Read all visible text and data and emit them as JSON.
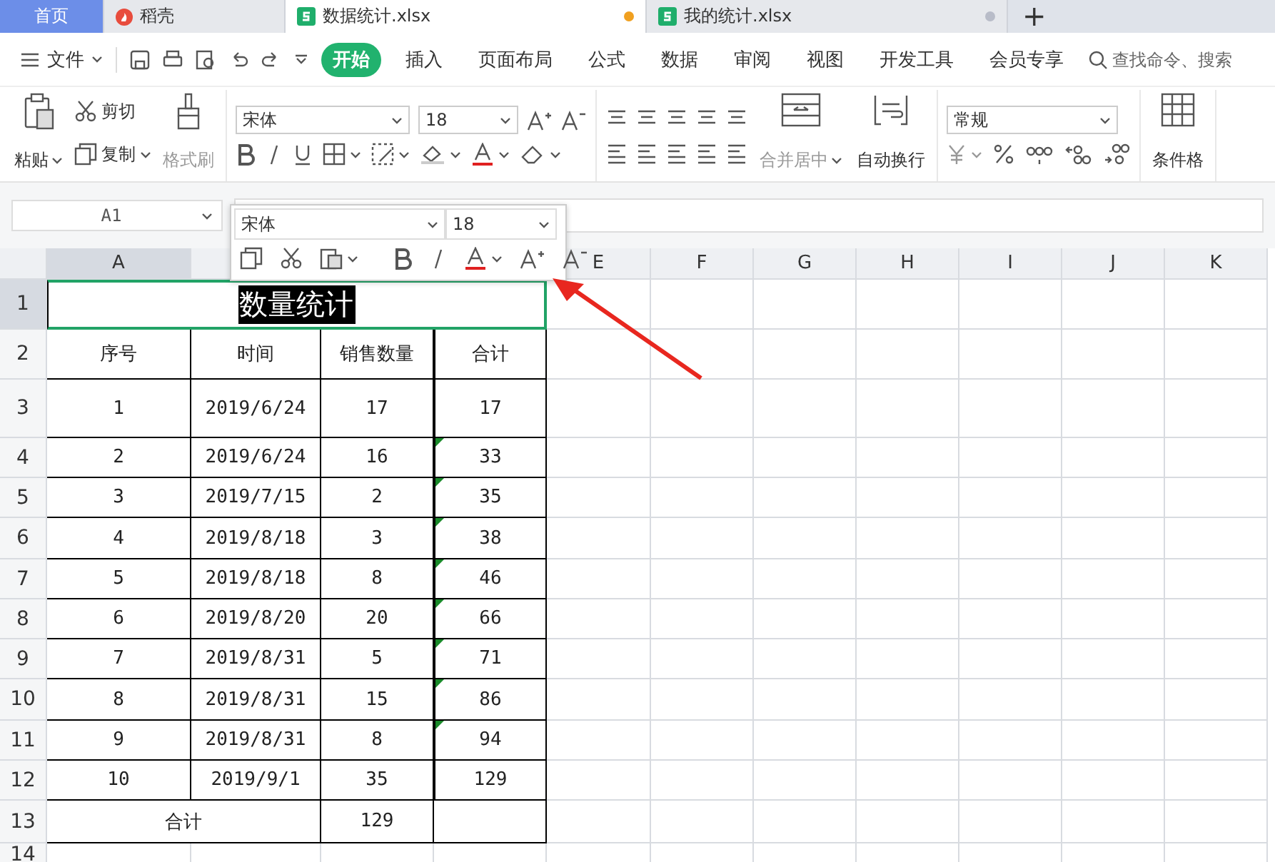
{
  "tabs": [
    {
      "label": "首页",
      "kind": "home",
      "selected": false
    },
    {
      "label": "稻壳",
      "kind": "docer",
      "selected": false
    },
    {
      "label": "数据统计.xlsx",
      "kind": "sheet",
      "selected": true,
      "unsaved": true
    },
    {
      "label": "我的统计.xlsx",
      "kind": "sheet",
      "selected": false,
      "unsaved": false
    }
  ],
  "new_tab": "+",
  "menu": {
    "file": "文件",
    "items": [
      {
        "label": "开始",
        "selected": true
      },
      {
        "label": "插入",
        "selected": false
      },
      {
        "label": "页面布局",
        "selected": false
      },
      {
        "label": "公式",
        "selected": false
      },
      {
        "label": "数据",
        "selected": false
      },
      {
        "label": "审阅",
        "selected": false
      },
      {
        "label": "视图",
        "selected": false
      },
      {
        "label": "开发工具",
        "selected": false
      },
      {
        "label": "会员专享",
        "selected": false
      }
    ],
    "search": {
      "placeholder": "查找命令、搜索"
    }
  },
  "ribbon": {
    "paste": "粘贴",
    "cut": "剪切",
    "copy": "复制",
    "format_painter": "格式刷",
    "font": "宋体",
    "size": "18",
    "merge": "合并居中",
    "wrap": "自动换行",
    "number_format": "常规",
    "conditional": "条件格"
  },
  "formula_bar": {
    "name_box": "A1"
  },
  "mini_toolbar": {
    "font": "宋体",
    "size": "18"
  },
  "sheet": {
    "columns": [
      {
        "label": "A",
        "selected": true
      },
      null,
      null,
      null,
      {
        "label": "E",
        "selected": false
      },
      {
        "label": "F",
        "selected": false
      },
      {
        "label": "G",
        "selected": false
      },
      {
        "label": "H",
        "selected": false
      },
      {
        "label": "I",
        "selected": false
      },
      {
        "label": "J",
        "selected": false
      },
      {
        "label": "K",
        "selected": false
      }
    ],
    "rows": [
      {
        "number": "1",
        "selected": true,
        "merged_title": {
          "text": "数量统计"
        },
        "cells": []
      },
      {
        "number": "2",
        "selected": false,
        "cells": [
          {
            "text": "序号"
          },
          {
            "text": "时间"
          },
          {
            "text": "销售数量"
          },
          {
            "text": "合计"
          }
        ]
      },
      {
        "number": "3",
        "selected": false,
        "cells": [
          {
            "text": "1"
          },
          {
            "text": "2019/6/24"
          },
          {
            "text": "17"
          },
          {
            "text": "17"
          }
        ]
      },
      {
        "number": "4",
        "selected": false,
        "cells": [
          {
            "text": "2"
          },
          {
            "text": "2019/6/24"
          },
          {
            "text": "16"
          },
          {
            "text": "33",
            "kind": "number_as_text"
          }
        ]
      },
      {
        "number": "5",
        "selected": false,
        "cells": [
          {
            "text": "3"
          },
          {
            "text": "2019/7/15"
          },
          {
            "text": "2"
          },
          {
            "text": "35",
            "kind": "number_as_text"
          }
        ]
      },
      {
        "number": "6",
        "selected": false,
        "cells": [
          {
            "text": "4"
          },
          {
            "text": "2019/8/18"
          },
          {
            "text": "3"
          },
          {
            "text": "38",
            "kind": "number_as_text"
          }
        ]
      },
      {
        "number": "7",
        "selected": false,
        "cells": [
          {
            "text": "5"
          },
          {
            "text": "2019/8/18"
          },
          {
            "text": "8"
          },
          {
            "text": "46",
            "kind": "number_as_text"
          }
        ]
      },
      {
        "number": "8",
        "selected": false,
        "cells": [
          {
            "text": "6"
          },
          {
            "text": "2019/8/20"
          },
          {
            "text": "20"
          },
          {
            "text": "66",
            "kind": "number_as_text"
          }
        ]
      },
      {
        "number": "9",
        "selected": false,
        "cells": [
          {
            "text": "7"
          },
          {
            "text": "2019/8/31"
          },
          {
            "text": "5"
          },
          {
            "text": "71",
            "kind": "number_as_text"
          }
        ]
      },
      {
        "number": "10",
        "selected": false,
        "cells": [
          {
            "text": "8"
          },
          {
            "text": "2019/8/31"
          },
          {
            "text": "15"
          },
          {
            "text": "86",
            "kind": "number_as_text"
          }
        ]
      },
      {
        "number": "11",
        "selected": false,
        "cells": [
          {
            "text": "9"
          },
          {
            "text": "2019/8/31"
          },
          {
            "text": "8"
          },
          {
            "text": "94",
            "kind": "number_as_text"
          }
        ]
      },
      {
        "number": "12",
        "selected": false,
        "cells": [
          {
            "text": "10"
          },
          {
            "text": "2019/9/1"
          },
          {
            "text": "35"
          },
          {
            "text": "129"
          }
        ]
      },
      {
        "number": "13",
        "selected": false,
        "summary": {
          "label": "合计",
          "value": "129"
        },
        "cells": []
      },
      {
        "number": "14",
        "selected": false,
        "cells": []
      }
    ]
  }
}
